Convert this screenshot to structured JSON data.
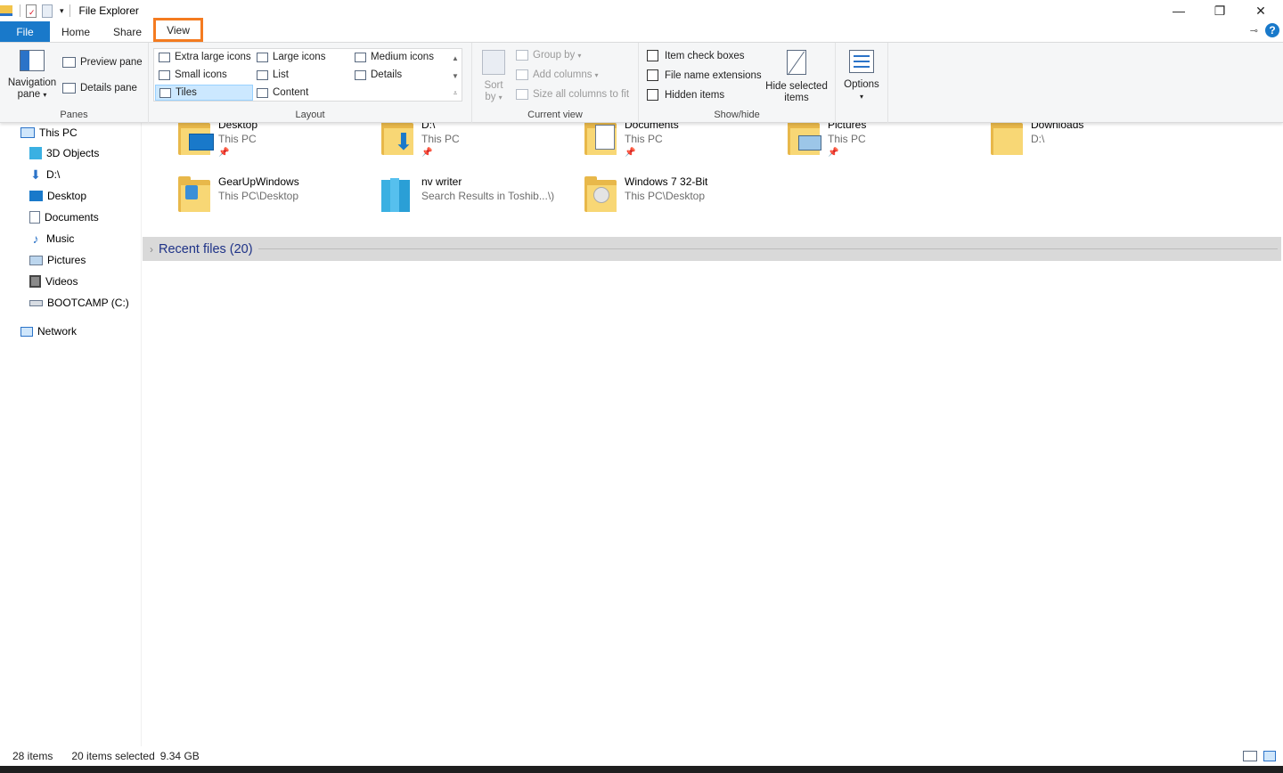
{
  "window": {
    "title": "File Explorer",
    "controls": {
      "minimize": "—",
      "maximize": "❐",
      "close": "✕"
    }
  },
  "tabs": {
    "file": "File",
    "home": "Home",
    "share": "Share",
    "view": "View",
    "help": "?"
  },
  "ribbon": {
    "panes": {
      "label": "Panes",
      "navigation_pane": "Navigation",
      "navigation_pane_2": "pane",
      "preview_pane": "Preview pane",
      "details_pane": "Details pane"
    },
    "layout": {
      "label": "Layout",
      "items": [
        "Extra large icons",
        "Large icons",
        "Medium icons",
        "Small icons",
        "List",
        "Details",
        "Tiles",
        "Content"
      ],
      "selected": "Tiles"
    },
    "current_view": {
      "label": "Current view",
      "sort_by": "Sort",
      "sort_by_2": "by",
      "group_by": "Group by",
      "add_columns": "Add columns",
      "size_columns": "Size all columns to fit"
    },
    "show_hide": {
      "label": "Show/hide",
      "item_check_boxes": "Item check boxes",
      "file_name_extensions": "File name extensions",
      "hidden_items": "Hidden items",
      "hide_selected": "Hide selected",
      "hide_selected_2": "items"
    },
    "options": {
      "label": "Options"
    }
  },
  "nav": {
    "this_pc": "This PC",
    "items": [
      "3D Objects",
      "D:\\",
      "Desktop",
      "Documents",
      "Music",
      "Pictures",
      "Videos",
      "BOOTCAMP (C:)"
    ],
    "network": "Network"
  },
  "tiles": [
    {
      "name": "Desktop",
      "sub": "This PC",
      "pinned": true
    },
    {
      "name": "D:\\",
      "sub": "This PC",
      "pinned": true
    },
    {
      "name": "Documents",
      "sub": "This PC",
      "pinned": true
    },
    {
      "name": "Pictures",
      "sub": "This PC",
      "pinned": true
    },
    {
      "name": "Downloads",
      "sub": "D:\\",
      "pinned": false
    },
    {
      "name": "GearUpWindows",
      "sub": "This PC\\Desktop",
      "pinned": false
    },
    {
      "name": "nv writer",
      "sub": "Search Results in Toshib...\\)",
      "pinned": false
    },
    {
      "name": "Windows 7 32-Bit",
      "sub": "This PC\\Desktop",
      "pinned": false
    }
  ],
  "recent": {
    "label": "Recent files (20)"
  },
  "status": {
    "item_count": "28 items",
    "selected": "20 items selected",
    "size": "9.34 GB"
  },
  "colors": {
    "accent": "#1979ca",
    "highlight": "#f47b20",
    "folder": "#f8d775",
    "group_header": "#1e3287"
  }
}
